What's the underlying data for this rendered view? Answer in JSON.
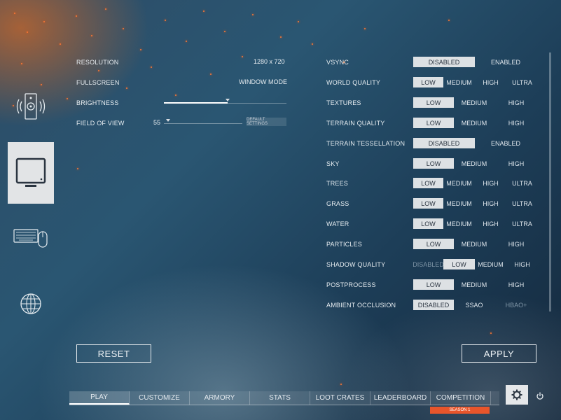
{
  "left_settings": {
    "resolution": {
      "label": "RESOLUTION",
      "value": "1280 x 720"
    },
    "fullscreen": {
      "label": "FULLSCREEN",
      "value": "WINDOW MODE"
    },
    "brightness": {
      "label": "BRIGHTNESS",
      "level": 0.52
    },
    "field_of_view": {
      "label": "FIELD OF VIEW",
      "value": "55",
      "level": 0.05
    },
    "default_settings_label": "DEFAULT SETTINGS"
  },
  "graphics": [
    {
      "label": "VSYNC",
      "options": [
        "DISABLED",
        "ENABLED"
      ],
      "selected": 0,
      "disabled": []
    },
    {
      "label": "WORLD QUALITY",
      "options": [
        "LOW",
        "MEDIUM",
        "HIGH",
        "ULTRA"
      ],
      "selected": 0,
      "disabled": []
    },
    {
      "label": "TEXTURES",
      "options": [
        "LOW",
        "MEDIUM",
        "HIGH"
      ],
      "selected": 0,
      "disabled": []
    },
    {
      "label": "TERRAIN QUALITY",
      "options": [
        "LOW",
        "MEDIUM",
        "HIGH"
      ],
      "selected": 0,
      "disabled": []
    },
    {
      "label": "TERRAIN TESSELLATION",
      "options": [
        "DISABLED",
        "ENABLED"
      ],
      "selected": 0,
      "disabled": []
    },
    {
      "label": "SKY",
      "options": [
        "LOW",
        "MEDIUM",
        "HIGH"
      ],
      "selected": 0,
      "disabled": []
    },
    {
      "label": "TREES",
      "options": [
        "LOW",
        "MEDIUM",
        "HIGH",
        "ULTRA"
      ],
      "selected": 0,
      "disabled": []
    },
    {
      "label": "GRASS",
      "options": [
        "LOW",
        "MEDIUM",
        "HIGH",
        "ULTRA"
      ],
      "selected": 0,
      "disabled": []
    },
    {
      "label": "WATER",
      "options": [
        "LOW",
        "MEDIUM",
        "HIGH",
        "ULTRA"
      ],
      "selected": 0,
      "disabled": []
    },
    {
      "label": "PARTICLES",
      "options": [
        "LOW",
        "MEDIUM",
        "HIGH"
      ],
      "selected": 0,
      "disabled": []
    },
    {
      "label": "SHADOW QUALITY",
      "options": [
        "DISABLED",
        "LOW",
        "MEDIUM",
        "HIGH"
      ],
      "selected": 1,
      "disabled": [
        0
      ]
    },
    {
      "label": "POSTPROCESS",
      "options": [
        "LOW",
        "MEDIUM",
        "HIGH"
      ],
      "selected": 0,
      "disabled": []
    },
    {
      "label": "AMBIENT OCCLUSION",
      "options": [
        "DISABLED",
        "SSAO",
        "HBAO+"
      ],
      "selected": 0,
      "disabled": [
        2
      ]
    }
  ],
  "buttons": {
    "reset": "RESET",
    "apply": "APPLY"
  },
  "tabs": [
    "PLAY",
    "CUSTOMIZE",
    "ARMORY",
    "STATS",
    "LOOT CRATES",
    "LEADERBOARD",
    "COMPETITION"
  ],
  "active_tab": 0,
  "season_badge": "SEASON 1",
  "nav_icons": [
    "speaker-icon",
    "monitor-icon",
    "keyboard-mouse-icon",
    "globe-icon"
  ],
  "colors": {
    "accent": "#e8552b",
    "selected": "#dde1e4"
  }
}
